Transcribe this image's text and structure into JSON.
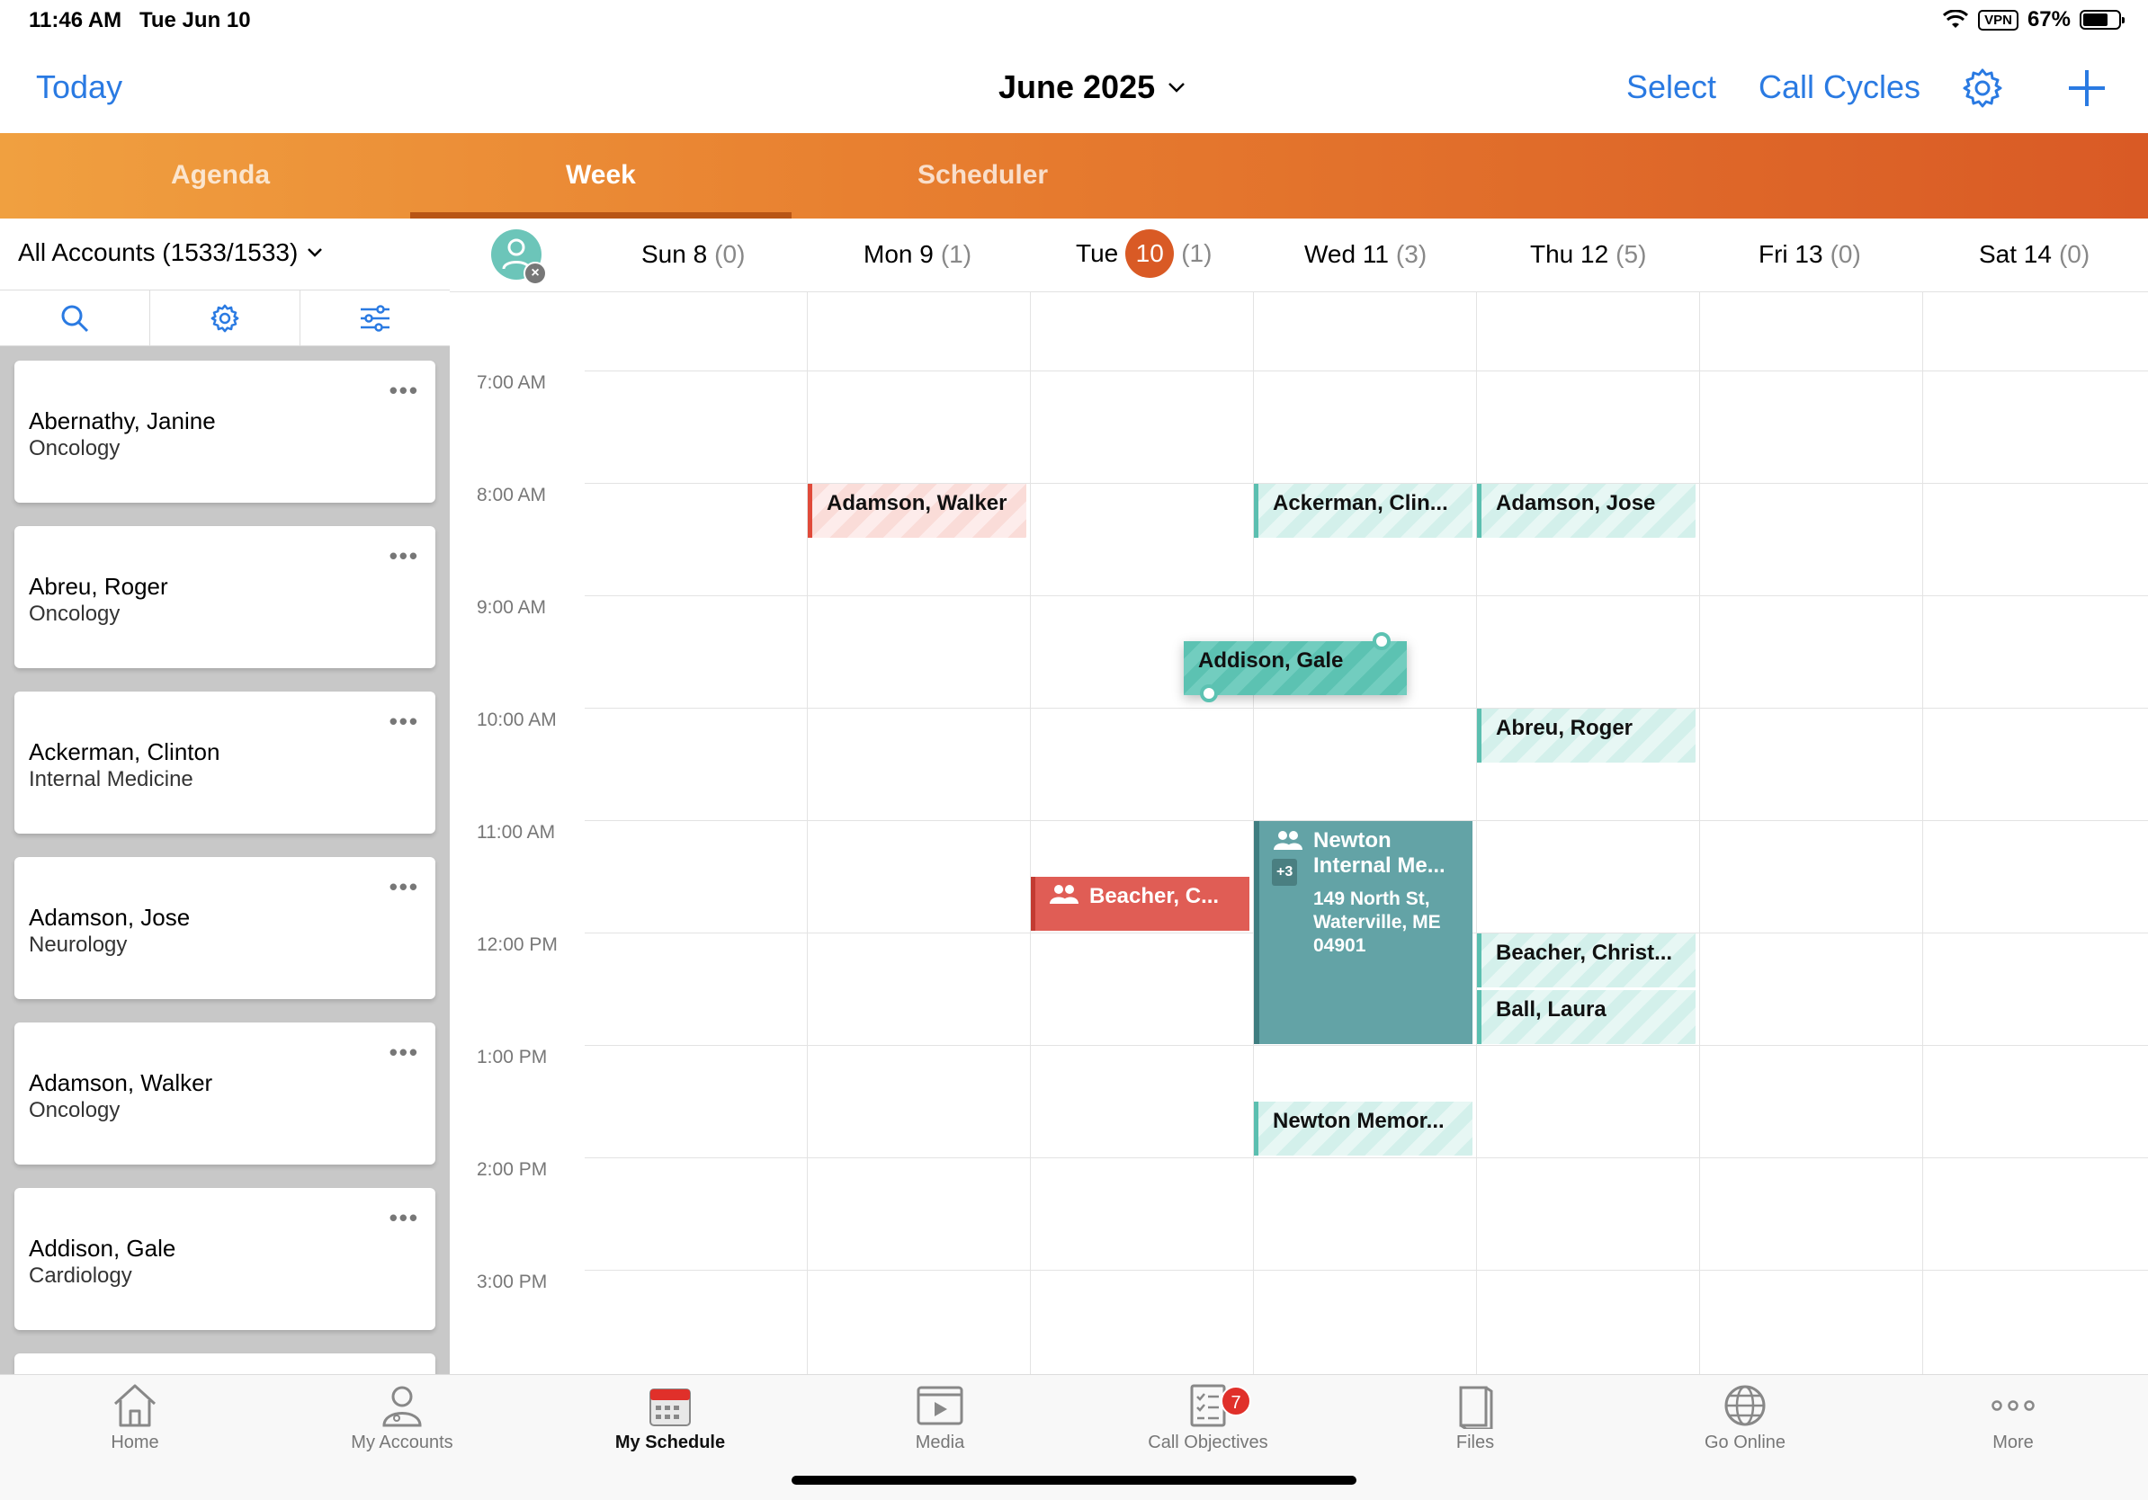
{
  "status": {
    "time": "11:46 AM",
    "date": "Tue Jun 10",
    "vpn": "VPN",
    "battery": "67%",
    "battery_level": 0.67
  },
  "nav": {
    "today": "Today",
    "title": "June 2025",
    "select": "Select",
    "call_cycles": "Call Cycles"
  },
  "tabs": {
    "agenda": "Agenda",
    "week": "Week",
    "scheduler": "Scheduler"
  },
  "accounts": {
    "filter": "All Accounts (1533/1533)",
    "list": [
      {
        "name": "Abernathy, Janine",
        "specialty": "Oncology"
      },
      {
        "name": "Abreu, Roger",
        "specialty": "Oncology"
      },
      {
        "name": "Ackerman, Clinton",
        "specialty": "Internal Medicine"
      },
      {
        "name": "Adamson, Jose",
        "specialty": "Neurology"
      },
      {
        "name": "Adamson, Walker",
        "specialty": "Oncology"
      },
      {
        "name": "Addison, Gale",
        "specialty": "Cardiology"
      }
    ]
  },
  "days": [
    {
      "label": "Sun 8",
      "count": "(0)"
    },
    {
      "label": "Mon 9",
      "count": "(1)"
    },
    {
      "label": "Tue",
      "num": "10",
      "count": "(1)"
    },
    {
      "label": "Wed 11",
      "count": "(3)"
    },
    {
      "label": "Thu 12",
      "count": "(5)"
    },
    {
      "label": "Fri 13",
      "count": "(0)"
    },
    {
      "label": "Sat 14",
      "count": "(0)"
    }
  ],
  "times": [
    "7:00 AM",
    "8:00 AM",
    "9:00 AM",
    "10:00 AM",
    "11:00 AM",
    "12:00 PM",
    "1:00 PM",
    "2:00 PM",
    "3:00 PM"
  ],
  "events": {
    "mon_adamson_walker": "Adamson, Walker",
    "wed_ackerman": "Ackerman, Clin...",
    "thu_adamson_jose": "Adamson, Jose",
    "drag_addison": "Addison, Gale",
    "thu_abreu": "Abreu, Roger",
    "tue_beacher": "Beacher, C...",
    "wed_newton_title": "Newton Internal Me...",
    "wed_newton_plus": "+3",
    "wed_newton_address": "149 North St, Waterville, ME 04901",
    "thu_beacher": "Beacher, Christ...",
    "thu_ball": "Ball, Laura",
    "wed_newton_memor": "Newton Memor..."
  },
  "bottom": {
    "home": "Home",
    "my_accounts": "My Accounts",
    "my_schedule": "My Schedule",
    "media": "Media",
    "call_objectives": "Call Objectives",
    "call_objectives_badge": "7",
    "files": "Files",
    "go_online": "Go Online",
    "more": "More"
  },
  "colors": {
    "accent": "#2a7ae2",
    "orange": "#e88030",
    "today": "#d95a25",
    "teal": "#5bbfb0"
  }
}
